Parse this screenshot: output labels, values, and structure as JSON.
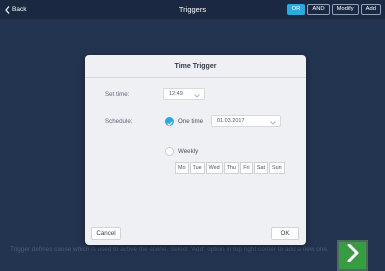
{
  "topbar": {
    "back_label": "Back",
    "title": "Triggers",
    "buttons": [
      {
        "label": "OR",
        "active": true
      },
      {
        "label": "AND",
        "active": false
      },
      {
        "label": "Modify",
        "active": false
      },
      {
        "label": "Add",
        "active": false
      }
    ]
  },
  "footer": {
    "hint": "Trigger defines cause which is used to active the scene. Select \"Add\" option in top right corner to add a new one."
  },
  "dialog": {
    "title": "Time Trigger",
    "set_time_label": "Set time:",
    "time_value": "12:49",
    "schedule_label": "Schedule:",
    "one_time_label": "One time",
    "date_value": "01.03.2017",
    "weekly_label": "Weekly",
    "selected_schedule": "one-time",
    "days": [
      "Mo",
      "Tue",
      "Wed",
      "Thu",
      "Fri",
      "Sat",
      "Sun"
    ],
    "cancel_label": "Cancel",
    "ok_label": "OK"
  },
  "colors": {
    "accent": "#2fa7df",
    "background": "#22324f",
    "topbar": "#1a2842",
    "next_button": "#3a9b45"
  },
  "icons": {
    "back": "chevron-left-icon",
    "next": "chevron-right-icon",
    "dropdown": "chevron-down-icon",
    "radio_checked": "check-icon"
  }
}
